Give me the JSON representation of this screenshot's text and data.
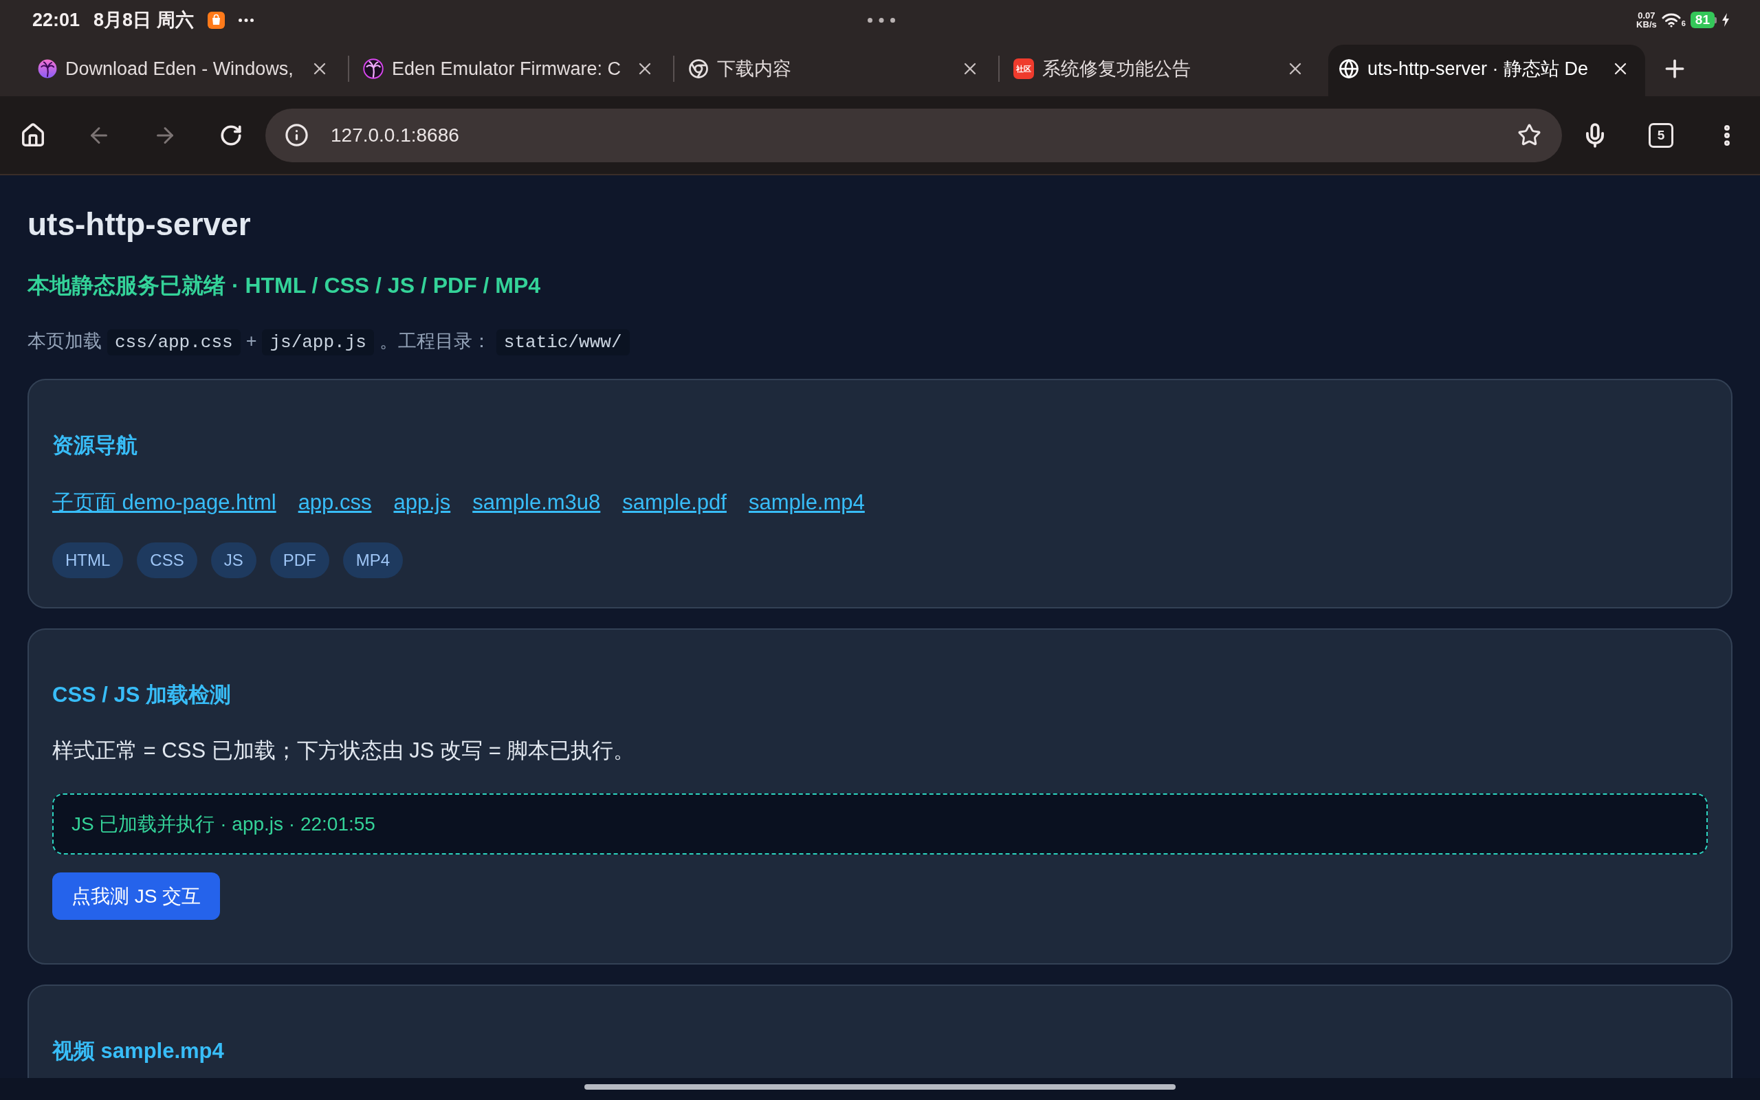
{
  "status_bar": {
    "time": "22:01",
    "date": "8月8日 周六",
    "network_speed": "0.07 KB/s",
    "wifi_standard": "6",
    "battery": "81",
    "charging": true
  },
  "tabs": [
    {
      "title": "Download Eden - Windows,",
      "selected": false
    },
    {
      "title": "Eden Emulator Firmware: C",
      "selected": false
    },
    {
      "title": "下载内容",
      "selected": false
    },
    {
      "title": "系统修复功能公告",
      "icon_text": "社区",
      "selected": false
    },
    {
      "title": "uts-http-server · 静态站 De",
      "selected": true
    }
  ],
  "toolbar": {
    "back": {
      "disabled": true
    },
    "forward": {
      "disabled": true
    },
    "url": "127.0.0.1:8686",
    "tab_count": "5"
  },
  "page": {
    "title": "uts-http-server",
    "subtitle": "本地静态服务已就绪 · HTML / CSS / JS / PDF / MP4",
    "intro": [
      {
        "kind": "text",
        "text": "本页加载"
      },
      {
        "kind": "code",
        "text": "css/app.css"
      },
      {
        "kind": "text",
        "text": "+"
      },
      {
        "kind": "code",
        "text": "js/app.js"
      },
      {
        "kind": "text",
        "text": "。工程目录："
      },
      {
        "kind": "code",
        "text": "static/www/"
      }
    ]
  },
  "cards": [
    {
      "kind": "links",
      "heading": "资源导航",
      "links": [
        "子页面 demo-page.html",
        "app.css",
        "app.js",
        "sample.m3u8",
        "sample.pdf",
        "sample.mp4"
      ],
      "tags": [
        "HTML",
        "CSS",
        "JS",
        "PDF",
        "MP4"
      ]
    },
    {
      "kind": "check",
      "heading": "CSS / JS 加载检测",
      "description": "样式正常 = CSS 已加载；下方状态由 JS 改写 = 脚本已执行。",
      "status": "JS 已加载并执行 · app.js · 22:01:55",
      "button": "点我测 JS 交互"
    },
    {
      "kind": "video",
      "heading": "视频 sample.mp4"
    }
  ]
}
